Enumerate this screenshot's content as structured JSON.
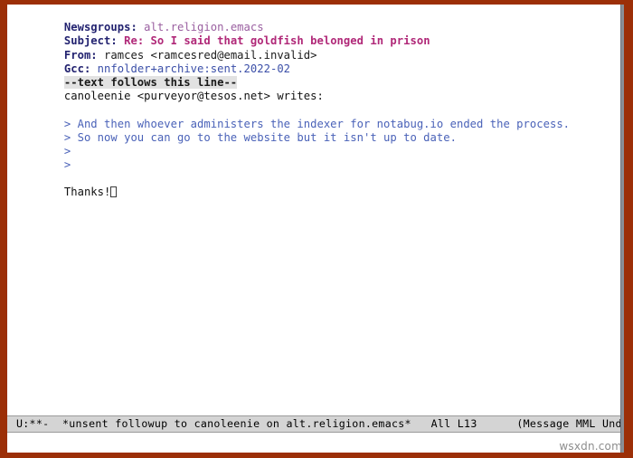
{
  "window": {
    "frame_color": "#9c2f07",
    "background": "#ffffff"
  },
  "headers": [
    {
      "name": "Newsgroups:",
      "value": " alt.religion.emacs",
      "value_style": "newsgroups",
      "color_name": "#232370",
      "color_value": "#9a5fa0"
    },
    {
      "name": "Subject:",
      "value": " Re: So I said that goldfish belonged in prison",
      "value_style": "subject",
      "color_name": "#232370",
      "color_value": "#b02878"
    },
    {
      "name": "From:",
      "value": " ramces <ramcesred@email.invalid>",
      "value_style": "plain",
      "color_name": "#232370",
      "color_value": "#1a1a1a"
    },
    {
      "name": "Gcc:",
      "value": " nnfolder+archive:sent.2022-02",
      "value_style": "gcc",
      "color_name": "#232370",
      "color_value": "#3b4fa8"
    }
  ],
  "separator": {
    "text": "--text follows this line--",
    "background": "#e2e2e2",
    "color": "#1a1a1a"
  },
  "body": {
    "attribution": "canoleenie <purveyor@tesos.net> writes:",
    "blank_after_attribution": "",
    "quoted_lines": [
      "> And then whoever administers the indexer for notabug.io ended the process.",
      "> So now you can go to the website but it isn't up to date.",
      ">",
      ">"
    ],
    "quote_color": "#4a62b8",
    "blank_line": "",
    "signoff": "Thanks!",
    "cursor": "hollow-block-cursor"
  },
  "mode_line": {
    "indicators": "U:**-",
    "gap_1": "  ",
    "buffer_name": "*unsent followup to canoleenie on alt.religion.emacs*",
    "gap_2": "   ",
    "position_scroll": "All",
    "gap_3": " ",
    "position_line": "L13",
    "gap_4": "      ",
    "modes": "(Message MML Undo-Tree",
    "background": "#d4d4d4",
    "foreground": "#000000"
  },
  "echo_area": {
    "text": ""
  },
  "watermark": {
    "text": "wsxdn.com",
    "color": "#8d8d8d"
  }
}
